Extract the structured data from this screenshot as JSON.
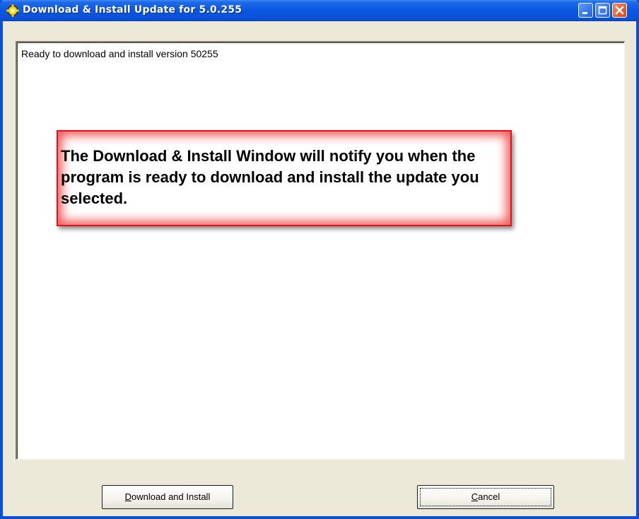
{
  "window": {
    "title": "Download & Install Update for 5.0.255",
    "app_icon": "sun-gear-icon"
  },
  "titlebar_buttons": {
    "minimize": "minimize-icon",
    "maximize": "maximize-icon",
    "close": "close-icon"
  },
  "content": {
    "status_text": "Ready to download and install version 50255"
  },
  "callout": {
    "text": "The Download & Install Window will notify you when the program is ready to download and install the update you selected.",
    "border_color": "#e3121a"
  },
  "buttons": {
    "download_install": {
      "mnemonic": "D",
      "rest": "ownload and Install"
    },
    "cancel": {
      "mnemonic": "C",
      "rest": "ancel"
    }
  },
  "colors": {
    "titlebar": "#0a57e0",
    "dialog_bg": "#ece9d8",
    "close_button": "#d8441c"
  }
}
